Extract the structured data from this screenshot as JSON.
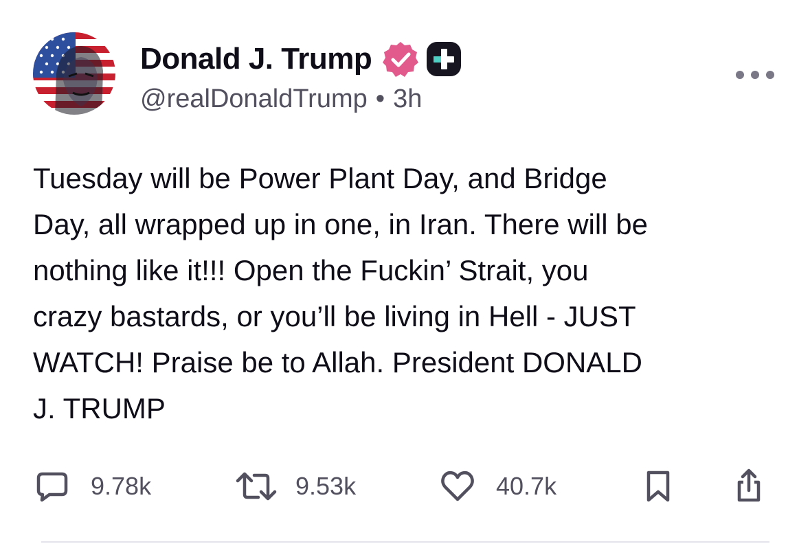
{
  "post": {
    "author": {
      "display_name": "Donald J. Trump",
      "handle": "@realDonaldTrump",
      "separator": "•",
      "time_ago": "3h",
      "verified_icon": "verified-check-icon",
      "badge_icon": "plus-badge-icon"
    },
    "body": "Tuesday will be Power Plant Day, and Bridge\nDay, all wrapped up in one, in Iran. There will be\nnothing like it!!! Open the Fuckin’ Strait, you\ncrazy bastards, or you’ll be living in Hell - JUST\nWATCH! Praise be to Allah. President DONALD\nJ. TRUMP",
    "menu_icon": "more-horizontal-icon",
    "actions": {
      "replies": {
        "count": "9.78k",
        "icon": "reply-icon"
      },
      "reposts": {
        "count": "9.53k",
        "icon": "repost-icon"
      },
      "likes": {
        "count": "40.7k",
        "icon": "heart-icon"
      },
      "bookmark": {
        "icon": "bookmark-icon"
      },
      "share": {
        "icon": "share-icon"
      }
    }
  },
  "colors": {
    "text_primary": "#0f0d17",
    "text_secondary": "#52505e",
    "verified_pink": "#e2598b",
    "badge_dark": "#171520",
    "badge_teal": "#4fd1c5",
    "divider": "#e4e2ea"
  }
}
